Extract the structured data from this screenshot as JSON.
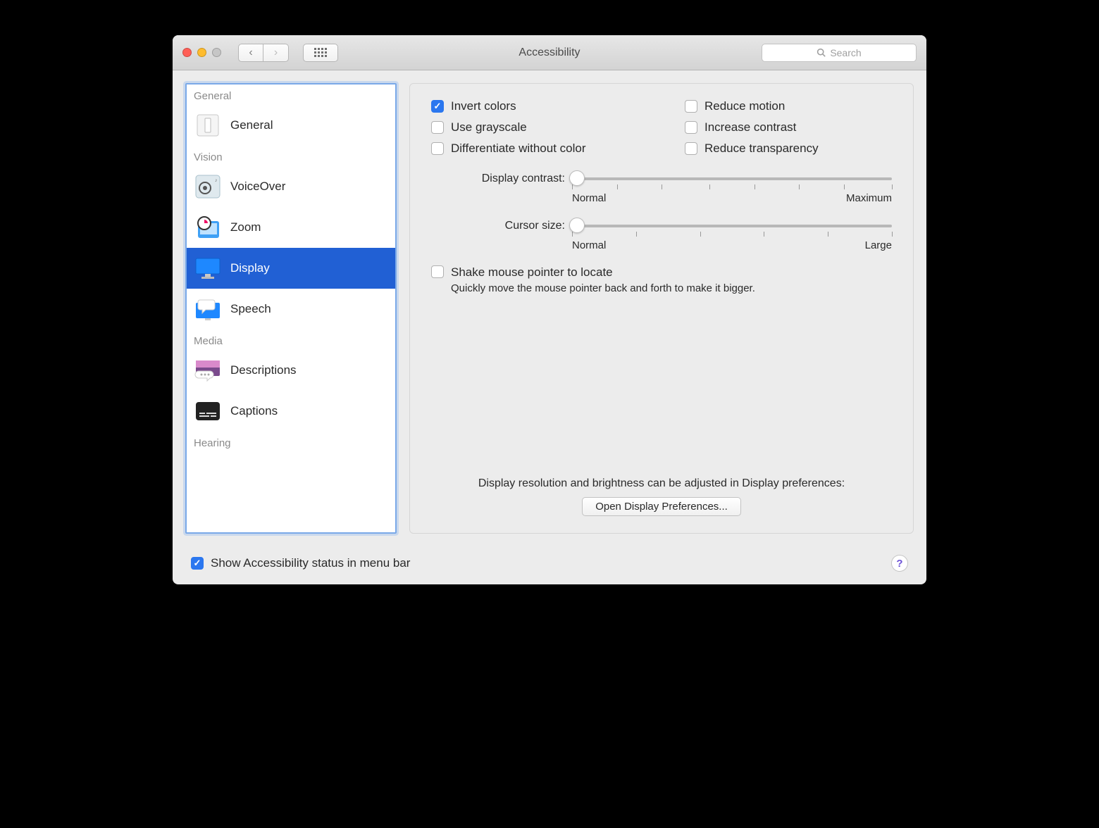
{
  "window": {
    "title": "Accessibility"
  },
  "search": {
    "placeholder": "Search"
  },
  "sidebar": {
    "sections": [
      {
        "label": "General",
        "items": [
          {
            "id": "general",
            "label": "General",
            "selected": false
          }
        ]
      },
      {
        "label": "Vision",
        "items": [
          {
            "id": "voiceover",
            "label": "VoiceOver",
            "selected": false
          },
          {
            "id": "zoom",
            "label": "Zoom",
            "selected": false
          },
          {
            "id": "display",
            "label": "Display",
            "selected": true
          },
          {
            "id": "speech",
            "label": "Speech",
            "selected": false
          }
        ]
      },
      {
        "label": "Media",
        "items": [
          {
            "id": "descriptions",
            "label": "Descriptions",
            "selected": false
          },
          {
            "id": "captions",
            "label": "Captions",
            "selected": false
          }
        ]
      },
      {
        "label": "Hearing",
        "items": []
      }
    ]
  },
  "options": {
    "invert_colors": {
      "label": "Invert colors",
      "checked": true
    },
    "reduce_motion": {
      "label": "Reduce motion",
      "checked": false
    },
    "use_grayscale": {
      "label": "Use grayscale",
      "checked": false
    },
    "increase_contrast": {
      "label": "Increase contrast",
      "checked": false
    },
    "differentiate": {
      "label": "Differentiate without color",
      "checked": false
    },
    "reduce_transparency": {
      "label": "Reduce transparency",
      "checked": false
    }
  },
  "sliders": {
    "contrast": {
      "label": "Display contrast:",
      "value": 0,
      "min_label": "Normal",
      "max_label": "Maximum"
    },
    "cursor": {
      "label": "Cursor size:",
      "value": 0,
      "min_label": "Normal",
      "max_label": "Large"
    }
  },
  "shake": {
    "label": "Shake mouse pointer to locate",
    "checked": false,
    "description": "Quickly move the mouse pointer back and forth to make it bigger."
  },
  "bottom": {
    "note": "Display resolution and brightness can be adjusted in Display preferences:",
    "button": "Open Display Preferences..."
  },
  "footer": {
    "show_status": {
      "label": "Show Accessibility status in menu bar",
      "checked": true
    }
  }
}
